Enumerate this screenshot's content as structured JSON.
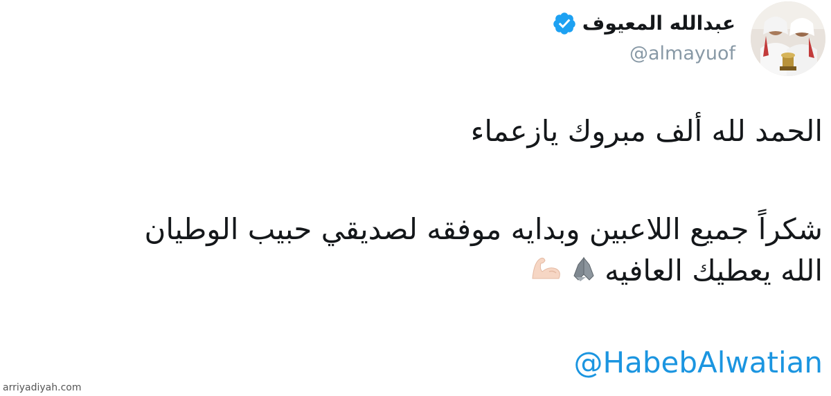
{
  "tweet": {
    "author": {
      "display_name": "عبدالله المعيوف",
      "handle": "@almayuof",
      "verified": true,
      "avatar_icon": "profile-photo"
    },
    "text": {
      "line1": "الحمد لله ألف مبروك يازعماء",
      "line2": "شكراً جميع اللاعبين وبدايه موفقه لصديقي حبيب الوطيان",
      "line3": "الله يعطيك العافيه"
    },
    "emojis": [
      "folded-hands-icon",
      "flexed-biceps-icon"
    ],
    "mention": "@HabebAlwatian"
  },
  "watermark": "arriyadiyah.com",
  "colors": {
    "text": "#14171a",
    "handle": "#8899a6",
    "link": "#1b95e0",
    "verified": "#1da1f2",
    "background": "#ffffff"
  }
}
